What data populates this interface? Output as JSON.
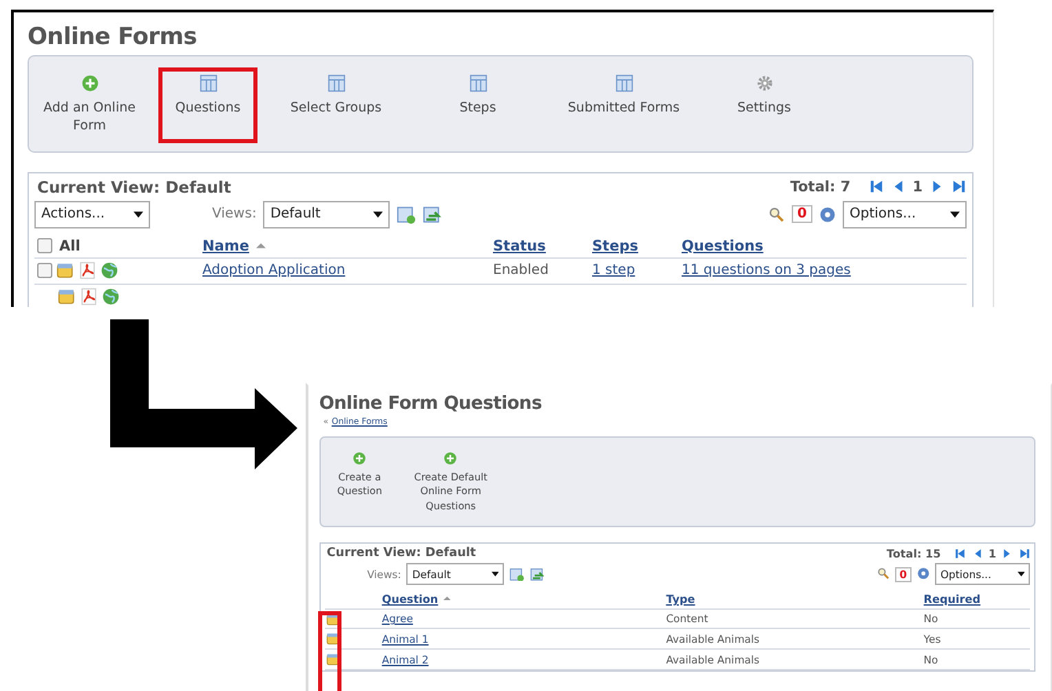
{
  "forms_screen": {
    "title": "Online Forms",
    "toolbar": [
      {
        "label": "Add an Online Form",
        "kind": "add",
        "highlighted": false
      },
      {
        "label": "Questions",
        "kind": "view",
        "highlighted": true
      },
      {
        "label": "Select Groups",
        "kind": "view",
        "highlighted": false
      },
      {
        "label": "Steps",
        "kind": "view",
        "highlighted": false
      },
      {
        "label": "Submitted Forms",
        "kind": "view",
        "highlighted": false
      },
      {
        "label": "Settings",
        "kind": "settings",
        "highlighted": false
      }
    ],
    "list": {
      "kind": "form_list",
      "view_title": "Current View: Default",
      "total": "Total: 7",
      "page": "1",
      "actions": "Actions...",
      "views_label": "Views:",
      "view": "Default",
      "filter_count": "0",
      "options": "Options...",
      "select_all": {
        "label": "All",
        "checked": false
      },
      "columns": [
        {
          "label": "Name",
          "kind": "link",
          "sorted": true
        },
        {
          "label": "Status",
          "kind": "text",
          "sorted": false
        },
        {
          "label": "Steps",
          "kind": "link",
          "sorted": false
        },
        {
          "label": "Questions",
          "kind": "link",
          "sorted": false
        }
      ],
      "rows": [
        {
          "cells": [
            "Adoption Application",
            "Enabled",
            "1 step",
            "11 questions on 3 pages"
          ],
          "checked": false
        }
      ],
      "icons_highlighted": false
    }
  },
  "questions_screen": {
    "title": "Online Form Questions",
    "breadcrumb": {
      "marker": "«",
      "link": "Online Forms"
    },
    "toolbar": [
      {
        "label": "Create a Question",
        "kind": "add",
        "highlighted": false
      },
      {
        "label": "Create Default Online Form Questions",
        "kind": "add",
        "highlighted": false
      }
    ],
    "list": {
      "kind": "question_list",
      "view_title": "Current View: Default",
      "total": "Total: 15",
      "page": "1",
      "views_label": "Views:",
      "view": "Default",
      "filter_count": "0",
      "options": "Options...",
      "columns": [
        {
          "label": "Question",
          "kind": "link",
          "sorted": true
        },
        {
          "label": "Type",
          "kind": "text",
          "sorted": false
        },
        {
          "label": "Required",
          "kind": "text",
          "sorted": false
        }
      ],
      "rows": [
        {
          "cells": [
            "Agree",
            "Content",
            "No"
          ]
        },
        {
          "cells": [
            "Animal 1",
            "Available Animals",
            "Yes"
          ]
        },
        {
          "cells": [
            "Animal 2",
            "Available Animals",
            "No"
          ]
        }
      ],
      "icons_highlighted": true
    }
  }
}
